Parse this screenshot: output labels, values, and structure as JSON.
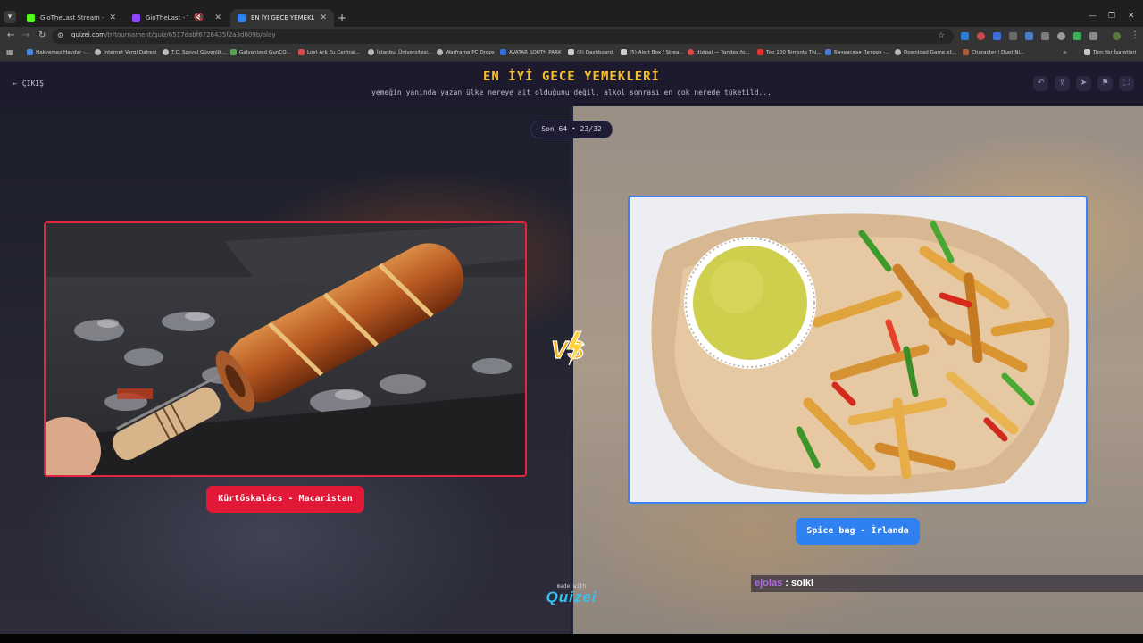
{
  "browser": {
    "tabs": [
      {
        "title": "GioTheLast Stream - Watch Liv",
        "icon_color": "#53fc18",
        "active": false
      },
      {
        "title": "GioTheLast - Twitch",
        "icon_color": "#9146ff",
        "active": false
      },
      {
        "title": "EN İYİ GECE YEMEKLERİ - Tier L",
        "icon_color": "#2f80f0",
        "active": true
      }
    ],
    "url_host": "quizei.com",
    "url_path": "/tr/tournament/quiz/6517dabf6726435f2a3d609b/play",
    "bookmarks": [
      "Hakyemez Haydar -...",
      "Internet Vergi Dairesi",
      "T.C. Sosyal Güvenlik...",
      "Galvanized GunCO...",
      "Lost Ark Eu Central...",
      "İstanbul Üniversitesi...",
      "Warframe PC Drops",
      "AVATAR SOUTH PARK",
      "(8) Dashboard",
      "(5) Alert Box / Strea...",
      "dizipal — Yandex:fo...",
      "Top 100 Torrents Thi...",
      "Бачевская Петров -...",
      "Download Game.ef...",
      "Character | Duet Ni..."
    ],
    "all_bookmarks": "Tüm Yer İşaretleri"
  },
  "header": {
    "exit_label": "ÇIKIŞ",
    "title": "EN İYİ GECE YEMEKLERİ",
    "subtitle": "yemeğin yanında yazan ülke nereye ait olduğunu değil, alkol sonrası en çok nerede tüketild..."
  },
  "round": "Son 64 • 23/32",
  "left": {
    "label": "Kürtőskalács - Macaristan",
    "border_color": "#e2263f"
  },
  "right": {
    "label": "Spice bag - İrlanda",
    "border_color": "#3b82f6"
  },
  "vs_label": "VS",
  "made_with": "made with",
  "brand": "Quizei",
  "chat": {
    "user": "ejolas",
    "message": " : solki"
  }
}
